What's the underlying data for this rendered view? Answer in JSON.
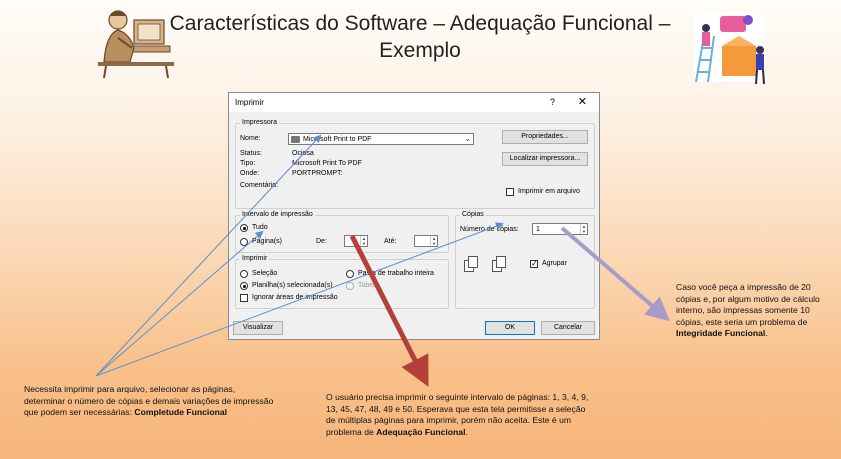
{
  "slide": {
    "title_line1": "Características do Software  – Adequação Funcional –",
    "title_line2": "Exemplo"
  },
  "dialog": {
    "title": "Imprimir",
    "help": "?",
    "close": "✕",
    "printer_group": "Impressora",
    "name_label": "Nome:",
    "name_value": "Microsoft Print to PDF",
    "status_label": "Status:",
    "status_value": "Ociosa",
    "type_label": "Tipo:",
    "type_value": "Microsoft Print To PDF",
    "where_label": "Onde:",
    "where_value": "PORTPROMPT:",
    "comment_label": "Comentário:",
    "properties_btn": "Propriedades...",
    "find_printer_btn": "Localizar impressora...",
    "print_to_file": "Imprimir em arquivo",
    "range_group": "Intervalo de impressão",
    "all": "Tudo",
    "pages": "Página(s)",
    "from_label": "De:",
    "to_label": "Até:",
    "print_group": "Imprimir",
    "selection": "Seleção",
    "active_sheets": "Planilha(s) selecionada(s)",
    "entire_workbook": "Pasta de trabalho inteira",
    "table": "Tabela",
    "ignore_print_areas": "Ignorar áreas de impressão",
    "copies_group": "Cópias",
    "num_copies_label": "Número de cópias:",
    "num_copies_value": "1",
    "collate": "Agrupar",
    "preview_btn": "Visualizar",
    "ok_btn": "OK",
    "cancel_btn": "Cancelar"
  },
  "notes": {
    "completeness_text": "Necessita imprimir para arquivo, selecionar as páginas, determinar o número de cópias e demais variações de impressão que podem ser necessárias: ",
    "completeness_bold": "Completude Funcional",
    "adequacy_text": "O usuário precisa imprimir o seguinte intervalo de páginas: 1, 3, 4, 9, 13, 45, 47, 48, 49 e 50. Esperava que esta tela permitisse a seleção de múltiplas páginas para imprimir, porém não aceita. Este é um problema de ",
    "adequacy_bold": "Adequação Funcional",
    "adequacy_end": ".",
    "integrity_text": "Caso você peça a impressão de 20 cópias e, por algum motivo de cálculo interno, são impressas somente 10 cópias, este seria um problema de  ",
    "integrity_bold": "Integridade Funcional",
    "integrity_end": "."
  },
  "colors": {
    "arrow_blue": "#5b8ec9",
    "arrow_red": "#b5403a",
    "arrow_purple": "#a89bc9"
  }
}
